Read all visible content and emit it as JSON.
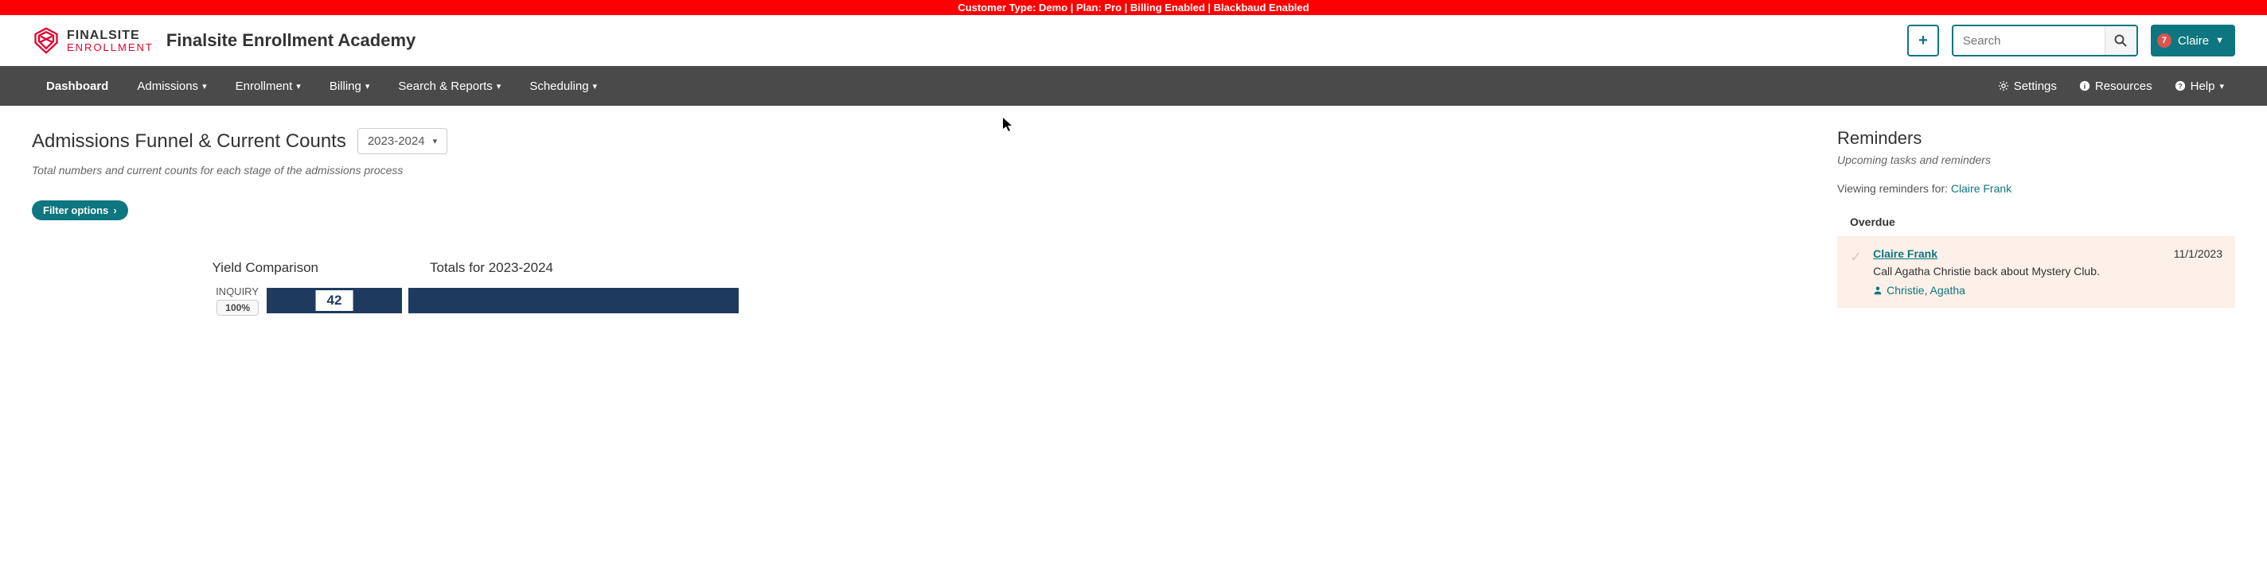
{
  "banner": {
    "text": "Customer Type: Demo | Plan: Pro | Billing Enabled | Blackbaud Enabled"
  },
  "header": {
    "logo_top": "FINALSITE",
    "logo_bottom": "ENROLLMENT",
    "site_title": "Finalsite Enrollment Academy",
    "search_placeholder": "Search",
    "notification_count": "7",
    "user_name": "Claire"
  },
  "nav": {
    "items": [
      "Dashboard",
      "Admissions",
      "Enrollment",
      "Billing",
      "Search & Reports",
      "Scheduling"
    ],
    "right_items": [
      "Settings",
      "Resources",
      "Help"
    ]
  },
  "funnel": {
    "title": "Admissions Funnel & Current Counts",
    "year": "2023-2024",
    "subtitle": "Total numbers and current counts for each stage of the admissions process",
    "filter_label": "Filter options",
    "yield_header": "Yield Comparison",
    "totals_header": "Totals for 2023-2024",
    "rows": [
      {
        "stage": "INQUIRY",
        "percent": "100%",
        "value": "42"
      }
    ]
  },
  "reminders": {
    "title": "Reminders",
    "subtitle": "Upcoming tasks and reminders",
    "viewing_label": "Viewing reminders for:",
    "viewing_name": "Claire Frank",
    "overdue_label": "Overdue",
    "items": [
      {
        "assignee": "Claire Frank",
        "date": "11/1/2023",
        "text": "Call Agatha Christie back about Mystery Club.",
        "contact": "Christie, Agatha"
      }
    ]
  },
  "chart_data": {
    "type": "bar",
    "title": "Admissions Funnel & Current Counts",
    "year": "2023-2024",
    "categories": [
      "INQUIRY"
    ],
    "series": [
      {
        "name": "Yield Comparison",
        "values_percent": [
          100
        ]
      },
      {
        "name": "Totals for 2023-2024",
        "values": [
          42
        ]
      }
    ]
  }
}
